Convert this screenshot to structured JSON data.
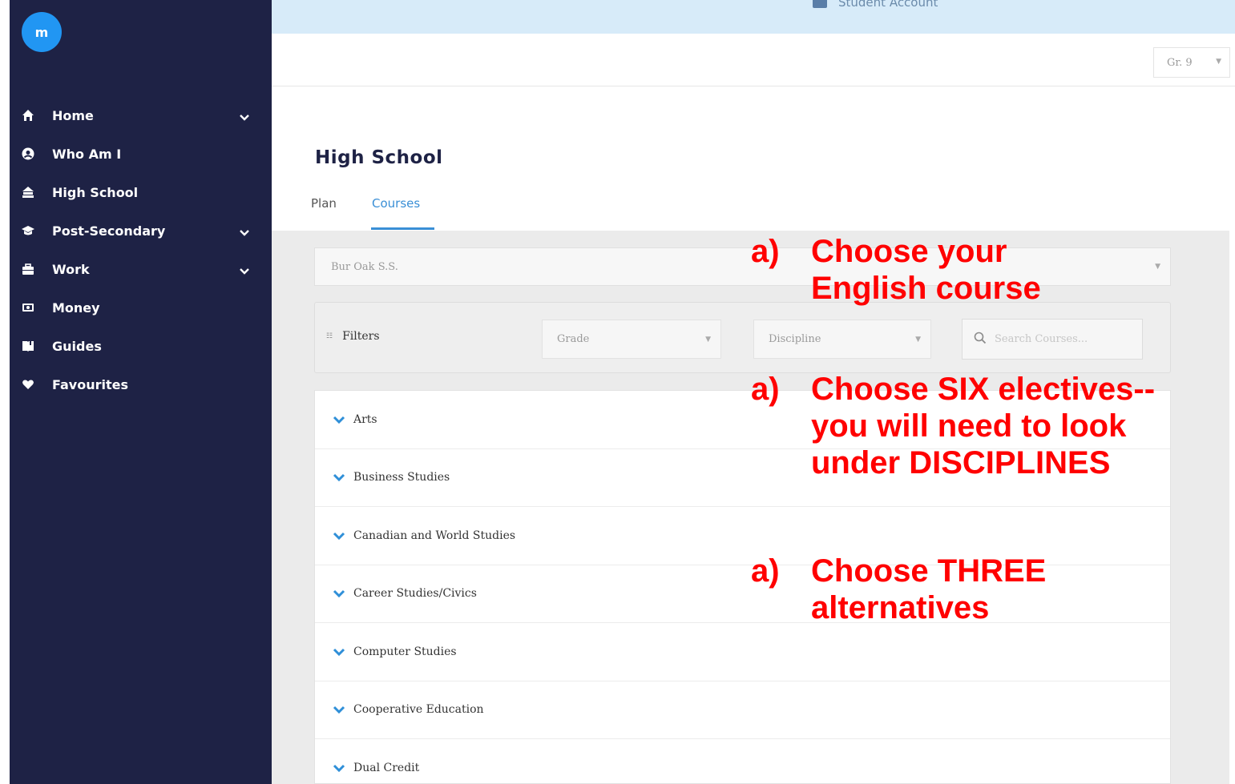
{
  "sidebar": {
    "logo": "m",
    "items": [
      {
        "label": "Home",
        "icon": "home-icon",
        "expandable": true
      },
      {
        "label": "Who Am I",
        "icon": "user-circle-icon",
        "expandable": false
      },
      {
        "label": "High School",
        "icon": "school-icon",
        "expandable": false
      },
      {
        "label": "Post-Secondary",
        "icon": "graduation-cap-icon",
        "expandable": true
      },
      {
        "label": "Work",
        "icon": "briefcase-icon",
        "expandable": true
      },
      {
        "label": "Money",
        "icon": "money-icon",
        "expandable": false
      },
      {
        "label": "Guides",
        "icon": "book-icon",
        "expandable": false
      },
      {
        "label": "Favourites",
        "icon": "heart-icon",
        "expandable": false
      }
    ]
  },
  "header": {
    "account_label": "Student Account",
    "grade_select": "Gr. 9"
  },
  "page": {
    "title": "High School",
    "tabs": [
      {
        "label": "Plan",
        "active": false
      },
      {
        "label": "Courses",
        "active": true
      }
    ]
  },
  "school_select": "Bur Oak S.S.",
  "filters": {
    "label": "Filters",
    "grade_placeholder": "Grade",
    "discipline_placeholder": "Discipline",
    "search_placeholder": "Search Courses..."
  },
  "disciplines": [
    "Arts",
    "Business Studies",
    "Canadian and World Studies",
    "Career Studies/Civics",
    "Computer Studies",
    "Cooperative Education",
    "Dual Credit"
  ],
  "annotations": [
    {
      "marker": "a)",
      "text": "Choose your\nEnglish course"
    },
    {
      "marker": "a)",
      "text": "Choose SIX electives--\nyou will need to look\nunder DISCIPLINES"
    },
    {
      "marker": "a)",
      "text": "Choose THREE\nalternatives"
    }
  ],
  "colors": {
    "sidebar": "#1e2245",
    "accent": "#3a8fd6",
    "annotation": "#ff0000",
    "logo": "#2196f3"
  }
}
